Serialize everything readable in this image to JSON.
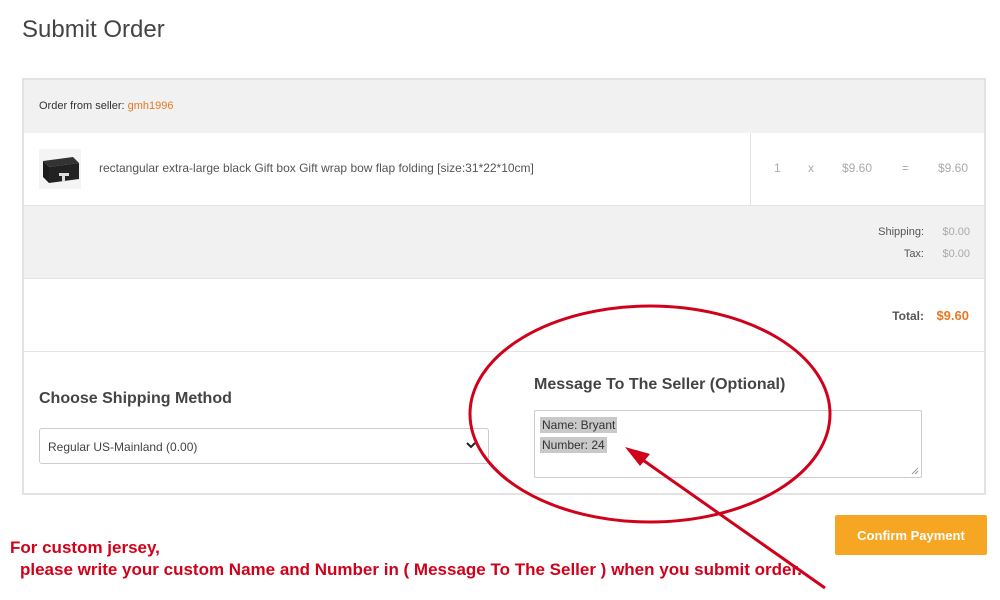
{
  "page": {
    "title": "Submit Order"
  },
  "seller": {
    "label": "Order from seller:",
    "name": "gmh1996"
  },
  "item": {
    "icon": "gift-box-image",
    "title": "rectangular extra-large black Gift box Gift wrap bow flap folding [size:31*22*10cm]",
    "quantity": "1",
    "times": "x",
    "unit_price": "$9.60",
    "equals": "=",
    "line_total": "$9.60"
  },
  "fees": {
    "shipping_label": "Shipping:",
    "shipping_value": "$0.00",
    "tax_label": "Tax:",
    "tax_value": "$0.00"
  },
  "total": {
    "label": "Total:",
    "value": "$9.60"
  },
  "shipping": {
    "title": "Choose Shipping Method",
    "selected": "Regular US-Mainland (0.00)"
  },
  "message": {
    "title": "Message To The Seller (Optional)",
    "lines": [
      "Name: Bryant",
      "Number: 24"
    ]
  },
  "actions": {
    "confirm_label": "Confirm Payment"
  },
  "annotation": {
    "line1": "For custom jersey,",
    "line2": "please write your custom Name and Number in  ( Message To The Seller )  when you submit order.",
    "color": "#d0021b"
  },
  "colors": {
    "accent": "#e87722",
    "button": "#f6a623"
  }
}
